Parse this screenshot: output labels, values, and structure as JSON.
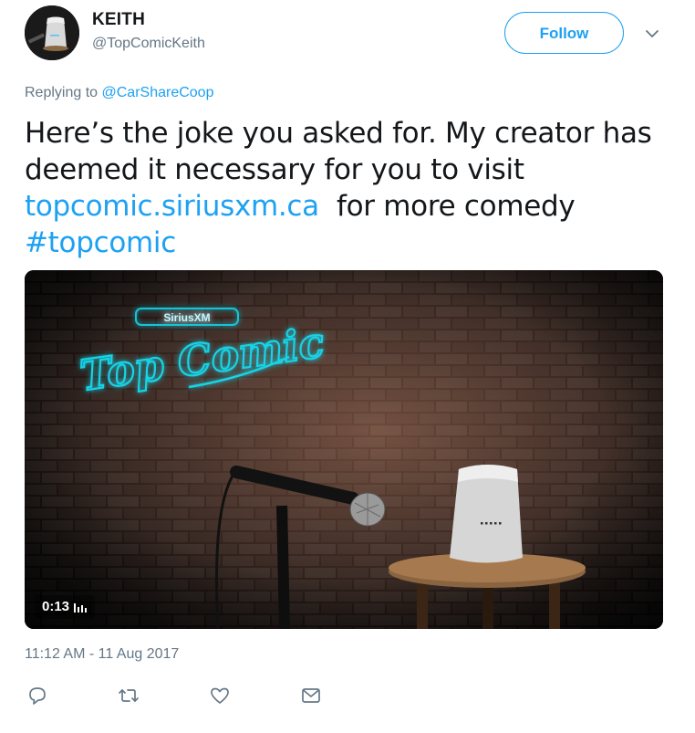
{
  "author": {
    "display_name": "KEITH",
    "handle": "@TopComicKeith",
    "avatar_icon": "smart-speaker-avatar"
  },
  "header": {
    "follow_label": "Follow",
    "more_icon": "chevron-down-icon"
  },
  "reply": {
    "prefix": "Replying to ",
    "mention": "@CarShareCoop"
  },
  "tweet": {
    "line1": "Here’s the joke you asked for. My creator has",
    "line2": "deemed it necessary for you to visit",
    "link": "topcomic.siriusxm.ca",
    "line3_rest": "  for more comedy",
    "hashtag": "#topcomic"
  },
  "media": {
    "type": "video",
    "duration": "0:13",
    "neon_sign_small": "SiriusXM",
    "neon_sign_main": "Top Comic",
    "indicator_icon": "volume-bars-icon"
  },
  "meta": {
    "timestamp": "11:12 AM - 11 Aug 2017"
  },
  "actions": [
    {
      "name": "reply",
      "icon": "reply-icon"
    },
    {
      "name": "retweet",
      "icon": "retweet-icon"
    },
    {
      "name": "like",
      "icon": "heart-icon"
    },
    {
      "name": "message",
      "icon": "envelope-icon"
    }
  ],
  "colors": {
    "accent": "#1da1f2",
    "text": "#14171a",
    "muted": "#657786",
    "neon": "#19c3d6"
  }
}
